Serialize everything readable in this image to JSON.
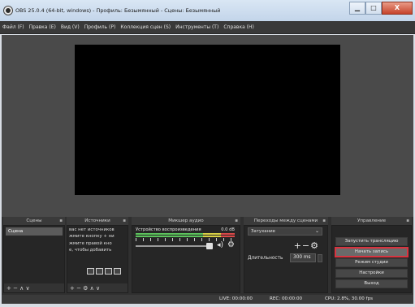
{
  "window": {
    "title": "OBS 25.0.4 (64-bit, windows) - Профиль: Безымянный - Сцены: Безымянный",
    "minimize_glyph": "▁",
    "maximize_glyph": "□",
    "close_glyph": "X"
  },
  "menu": [
    "Файл (F)",
    "Правка (E)",
    "Вид (V)",
    "Профиль (P)",
    "Коллекция сцен (S)",
    "Инструменты (T)",
    "Справка (H)"
  ],
  "docks": {
    "scenes": {
      "title": "Сцены",
      "items": [
        "Сцена"
      ],
      "toolbar": "+ − ∧ ∨"
    },
    "sources": {
      "title": "Источники",
      "lines": [
        "вас нет источников",
        "жмите кнопку + ни",
        "жмите правой кно",
        "е, чтобы добавить"
      ],
      "toolbar": "+ − ⚙ ∧ ∨"
    },
    "mixer": {
      "title": "Микшер аудио",
      "channel_label": "Устройство воспроизведения",
      "level": "0.0 dB"
    },
    "transitions": {
      "title": "Переходы между сценами",
      "selected": "Затухание",
      "duration_label": "Длительность",
      "duration_value": "300 ms"
    },
    "controls": {
      "title": "Управление",
      "buttons": [
        "Запустить трансляцию",
        "Начать запись",
        "Режим студии",
        "Настройки",
        "Выход"
      ]
    }
  },
  "status": {
    "live": "LIVE: 00:00:00",
    "rec": "REC: 00:00:00",
    "cpu": "CPU: 2.8%, 30.00 fps"
  },
  "colors": {
    "highlight": "#d9333f",
    "meter_green": "#5cc35c",
    "meter_yellow": "#d7cf45",
    "meter_red": "#d94848"
  }
}
